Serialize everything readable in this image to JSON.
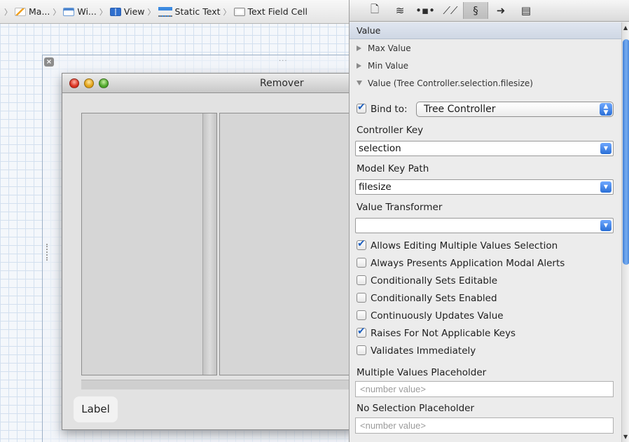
{
  "jumpbar": {
    "crumbs": [
      {
        "label": "Ma...",
        "icon": "menu-icon"
      },
      {
        "label": "Wi...",
        "icon": "window-icon"
      },
      {
        "label": "View",
        "icon": "view-icon"
      },
      {
        "label": "Static Text",
        "icon": "static-text-icon"
      },
      {
        "label": "Text Field Cell",
        "icon": "text-field-cell-icon"
      }
    ]
  },
  "canvas": {
    "outer_close": "×",
    "outer_handle": "···",
    "window_title": "Remover",
    "label_text": "Label"
  },
  "inspector": {
    "toolbar": {
      "icons": [
        "file-icon",
        "quick-help-icon",
        "identity-icon",
        "attributes-icon",
        "size-icon",
        "bindings-icon",
        "connections-icon"
      ],
      "active": "bindings-icon"
    },
    "section_title": "Value",
    "disclosures": {
      "max_value": "Max Value",
      "min_value": "Min Value",
      "value": "Value (Tree Controller.selection.filesize)"
    },
    "bind_to": {
      "label": "Bind to:",
      "checked": true,
      "value": "Tree Controller"
    },
    "controller_key": {
      "label": "Controller Key",
      "value": "selection"
    },
    "model_key_path": {
      "label": "Model Key Path",
      "value": "filesize"
    },
    "value_transformer": {
      "label": "Value Transformer",
      "value": ""
    },
    "options": [
      {
        "label": "Allows Editing Multiple Values Selection",
        "checked": true
      },
      {
        "label": "Always Presents Application Modal Alerts",
        "checked": false
      },
      {
        "label": "Conditionally Sets Editable",
        "checked": false
      },
      {
        "label": "Conditionally Sets Enabled",
        "checked": false
      },
      {
        "label": "Continuously Updates Value",
        "checked": false
      },
      {
        "label": "Raises For Not Applicable Keys",
        "checked": true
      },
      {
        "label": "Validates Immediately",
        "checked": false
      }
    ],
    "multiple_values_placeholder": {
      "label": "Multiple Values Placeholder",
      "placeholder": "<number value>"
    },
    "no_selection_placeholder": {
      "label": "No Selection Placeholder",
      "placeholder": "<number value>"
    }
  },
  "colors": {
    "accent": "#2a6fd6",
    "grid": "#d3e0ef",
    "section_header": "#d6dde9"
  }
}
